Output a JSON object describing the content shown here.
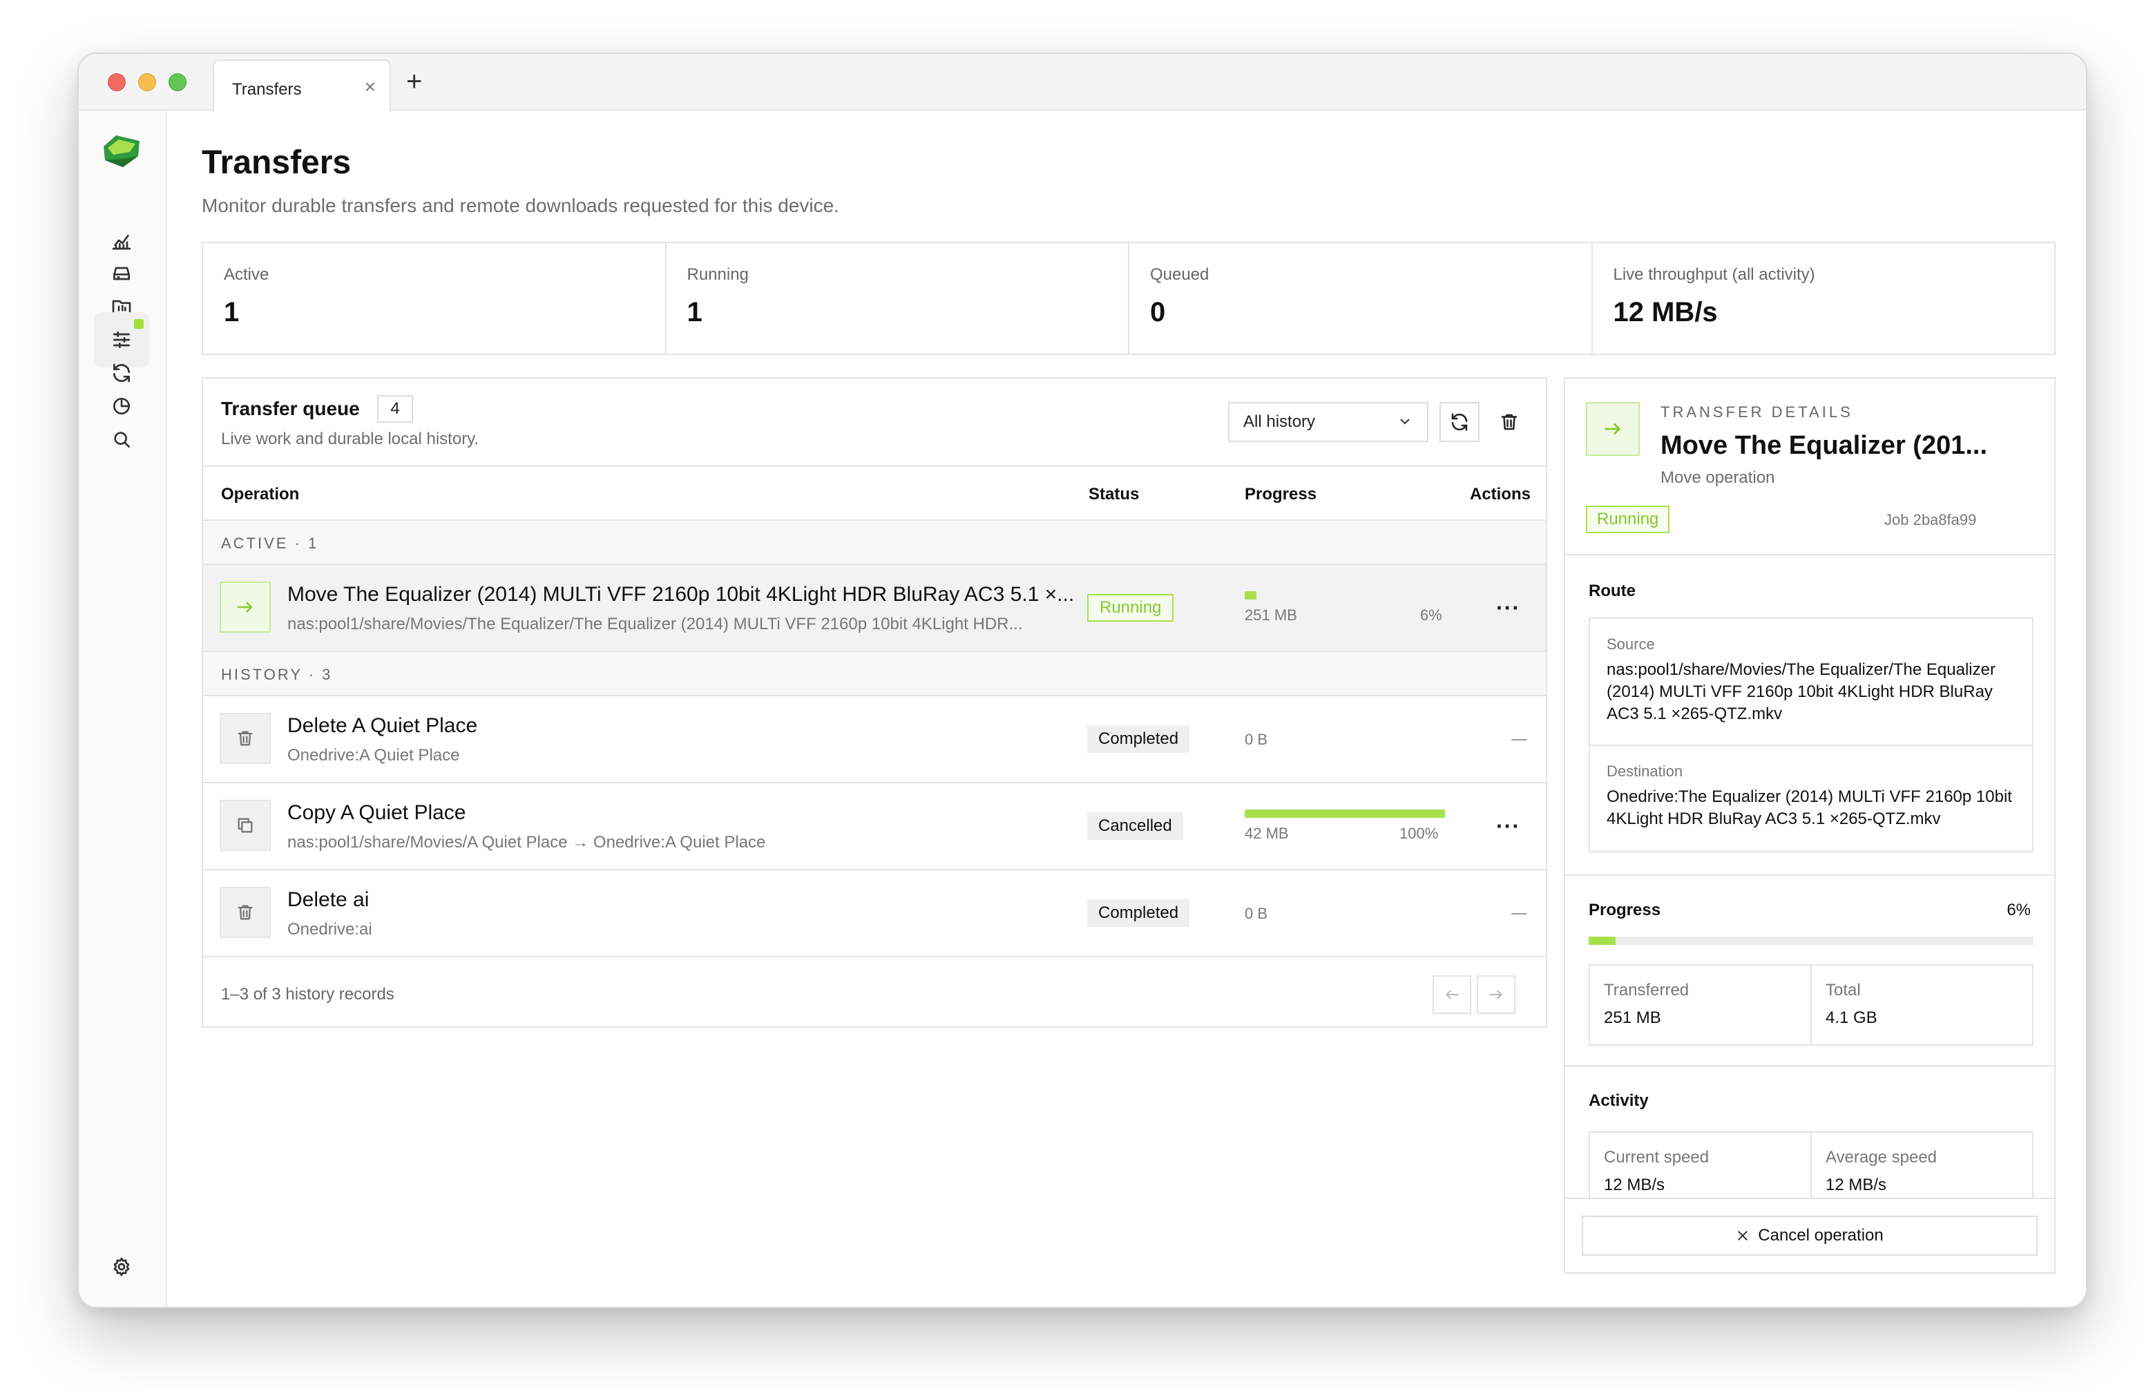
{
  "tab": {
    "label": "Transfers"
  },
  "page": {
    "title": "Transfers",
    "subtitle": "Monitor durable transfers and remote downloads requested for this device."
  },
  "stats": [
    {
      "label": "Active",
      "value": "1"
    },
    {
      "label": "Running",
      "value": "1"
    },
    {
      "label": "Queued",
      "value": "0"
    },
    {
      "label": "Live throughput (all activity)",
      "value": "12 MB/s"
    }
  ],
  "queue": {
    "title": "Transfer queue",
    "count": "4",
    "subtitle": "Live work and durable local history.",
    "filter": "All history",
    "columns": {
      "operation": "Operation",
      "status": "Status",
      "progress": "Progress",
      "actions": "Actions"
    },
    "active_group": "ACTIVE · 1",
    "history_group": "HISTORY · 3",
    "active": {
      "title": "Move The Equalizer (2014) MULTi VFF 2160p 10bit 4KLight HDR BluRay AC3 5.1 ×...",
      "path": "nas:pool1/share/Movies/The Equalizer/The Equalizer (2014) MULTi VFF 2160p 10bit 4KLight HDR...",
      "status": "Running",
      "size": "251 MB",
      "pct": "6%",
      "progress": 0.06
    },
    "history": [
      {
        "title": "Delete A Quiet Place",
        "path": "Onedrive:A Quiet Place",
        "status": "Completed",
        "size": "0 B",
        "icon": "trash-icon"
      },
      {
        "title": "Copy A Quiet Place",
        "path": "nas:pool1/share/Movies/A Quiet Place → Onedrive:A Quiet Place",
        "status": "Cancelled",
        "size": "42 MB",
        "pct": "100%",
        "progress": 1.0,
        "icon": "copy-icon"
      },
      {
        "title": "Delete ai",
        "path": "Onedrive:ai",
        "status": "Completed",
        "size": "0 B",
        "icon": "trash-icon"
      }
    ],
    "footer": "1–3 of 3 history records"
  },
  "details": {
    "kicker": "TRANSFER DETAILS",
    "title": "Move The Equalizer (201...",
    "subtitle": "Move operation",
    "status": "Running",
    "job": "Job 2ba8fa99",
    "route_label": "Route",
    "source_label": "Source",
    "source": "nas:pool1/share/Movies/The Equalizer/The Equalizer (2014) MULTi VFF 2160p 10bit 4KLight HDR BluRay AC3 5.1 ×265-QTZ.mkv",
    "destination_label": "Destination",
    "destination": "Onedrive:The Equalizer (2014) MULTi VFF 2160p 10bit 4KLight HDR BluRay AC3 5.1 ×265-QTZ.mkv",
    "progress_label": "Progress",
    "progress_pct": "6%",
    "progress": 0.06,
    "transferred_label": "Transferred",
    "transferred": "251 MB",
    "total_label": "Total",
    "total": "4.1 GB",
    "activity_label": "Activity",
    "current_speed_label": "Current speed",
    "current_speed": "12 MB/s",
    "average_speed_label": "Average speed",
    "average_speed": "12 MB/s",
    "cancel_label": "Cancel operation"
  },
  "colors": {
    "accent": "#a8e04c",
    "accent_text": "#84c92e"
  }
}
